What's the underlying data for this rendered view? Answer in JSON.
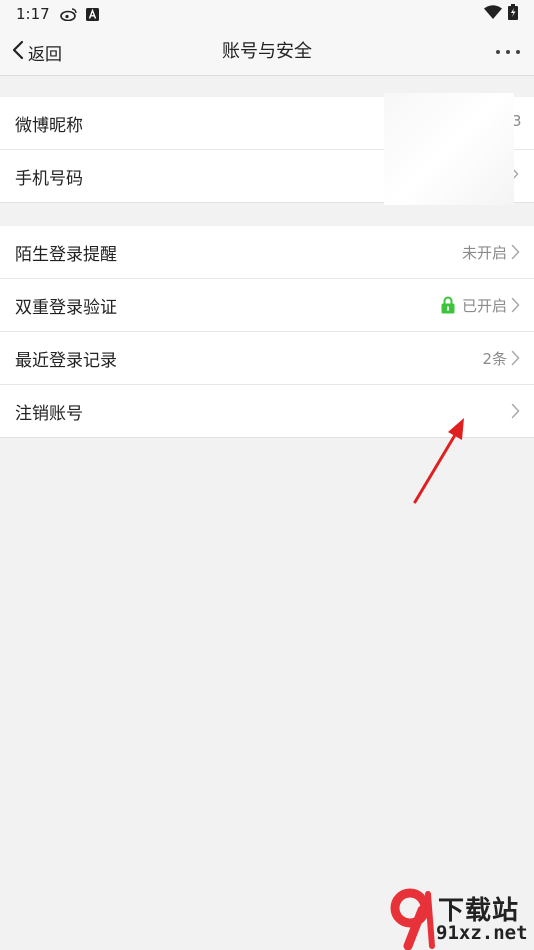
{
  "status_bar": {
    "time": "1:17",
    "icons": [
      "weibo-icon",
      "a-badge-icon",
      "wifi-icon",
      "battery-charging-icon"
    ]
  },
  "nav": {
    "back_label": "返回",
    "title": "账号与安全",
    "more_icon": "more-dots-icon"
  },
  "group1": [
    {
      "label": "微博昵称",
      "value": "3"
    },
    {
      "label": "手机号码",
      "value": ""
    }
  ],
  "group2": [
    {
      "label": "陌生登录提醒",
      "value": "未开启"
    },
    {
      "label": "双重登录验证",
      "value": "已开启",
      "icon": "lock-icon"
    },
    {
      "label": "最近登录记录",
      "value": "2条"
    },
    {
      "label": "注销账号",
      "value": ""
    }
  ],
  "colors": {
    "background": "#f2f2f2",
    "lock_green": "#3cc43c",
    "annotation_red": "#e02020"
  },
  "watermark": {
    "brand": "下载站",
    "url": "91xz.net"
  }
}
